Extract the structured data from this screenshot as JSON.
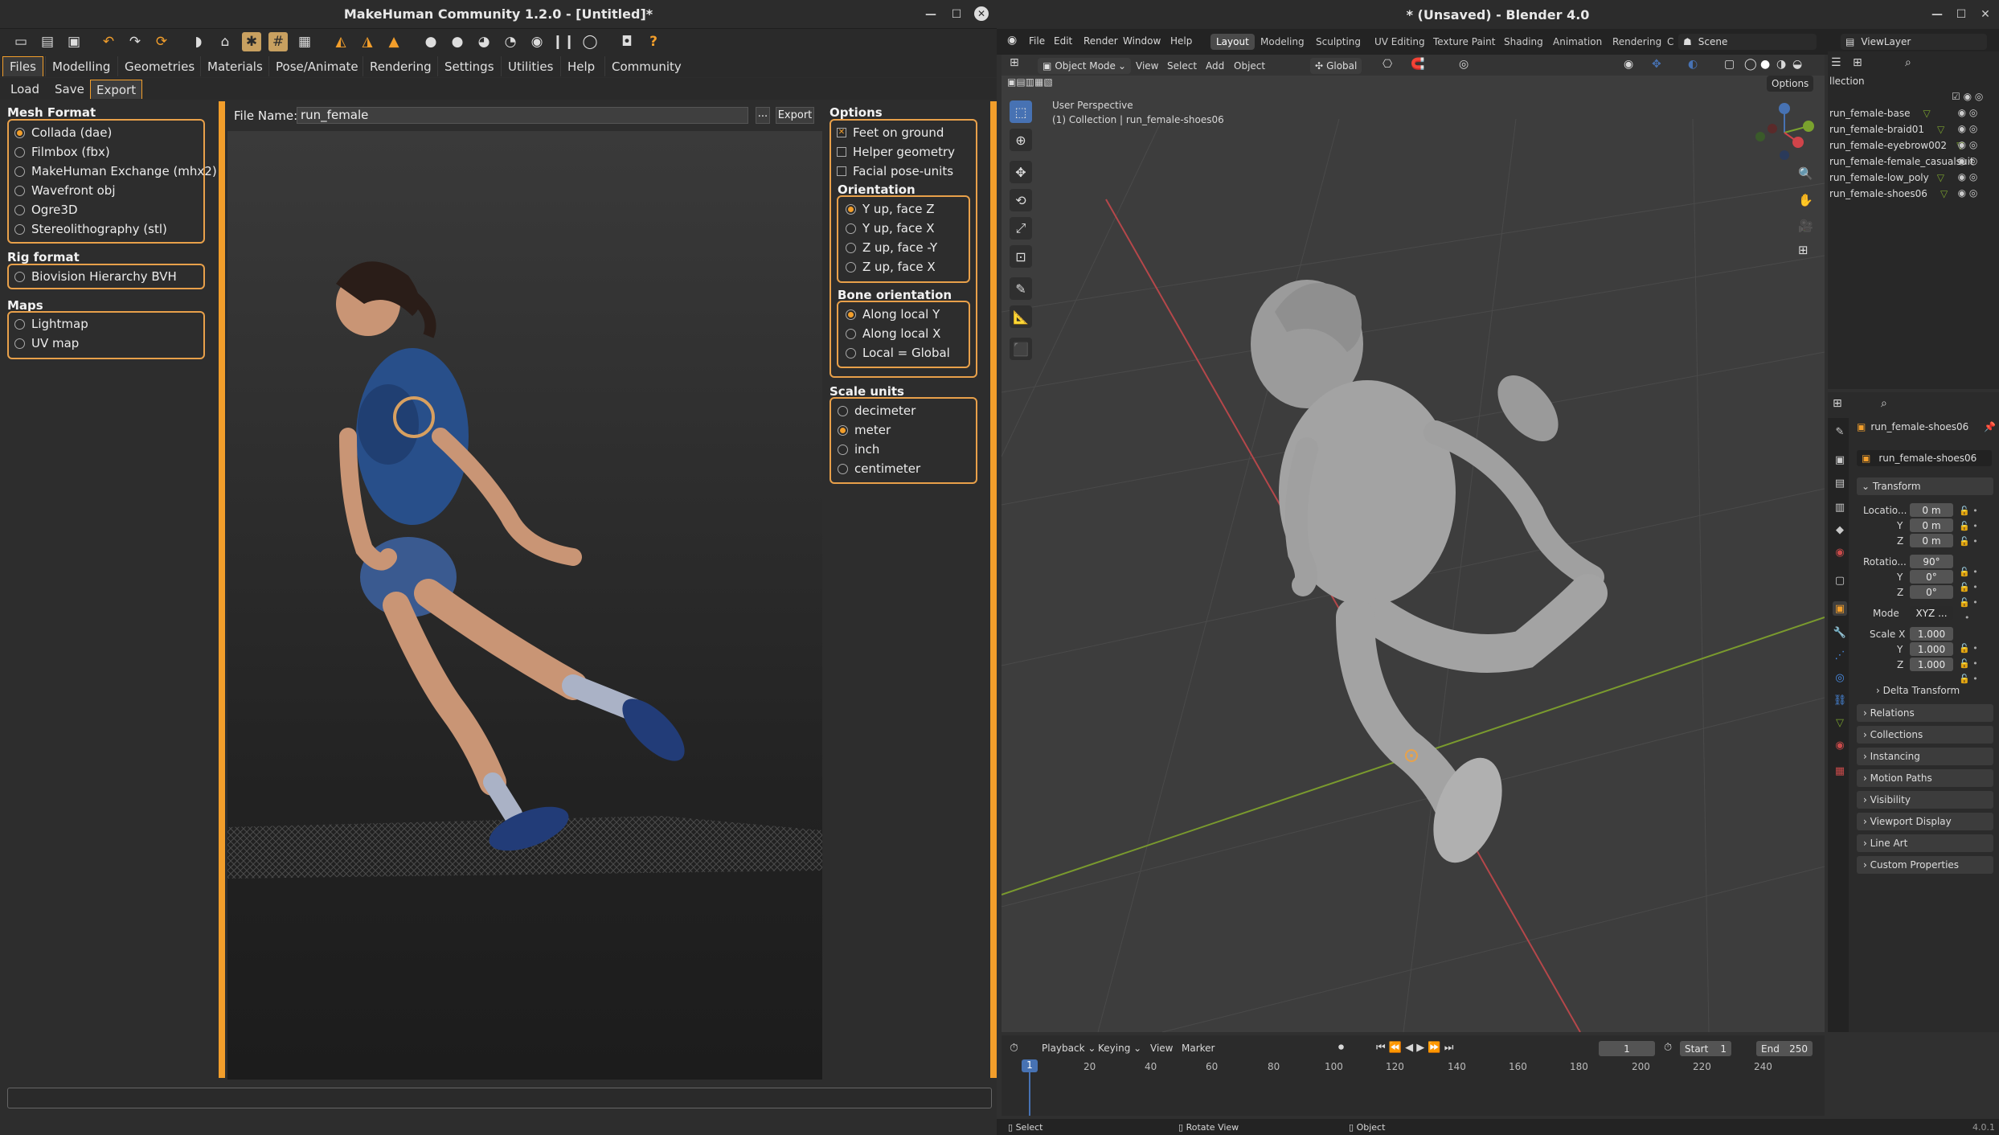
{
  "makehuman": {
    "title": "MakeHuman Community 1.2.0 - [Untitled]*",
    "tabs": [
      "Files",
      "Modelling",
      "Geometries",
      "Materials",
      "Pose/Animate",
      "Rendering",
      "Settings",
      "Utilities",
      "Help",
      "Community"
    ],
    "subtabs": [
      "Load",
      "Save",
      "Export"
    ],
    "mesh_format": {
      "title": "Mesh Format",
      "options": [
        "Collada (dae)",
        "Filmbox (fbx)",
        "MakeHuman Exchange (mhx2)",
        "Wavefront obj",
        "Ogre3D",
        "Stereolithography (stl)"
      ],
      "selected": 0
    },
    "rig_format": {
      "title": "Rig format",
      "options": [
        "Biovision Hierarchy BVH"
      ]
    },
    "maps": {
      "title": "Maps",
      "options": [
        "Lightmap",
        "UV map"
      ]
    },
    "file_name_label": "File Name:",
    "file_name_value": "run_female",
    "browse_label": "...",
    "export_label": "Export",
    "options": {
      "title": "Options",
      "items": [
        "Feet on ground",
        "Helper geometry",
        "Facial pose-units"
      ],
      "checked": [
        true,
        false,
        false
      ]
    },
    "orientation": {
      "title": "Orientation",
      "options": [
        "Y up, face Z",
        "Y up, face X",
        "Z up, face -Y",
        "Z up, face X"
      ],
      "selected": 0
    },
    "bone_orientation": {
      "title": "Bone orientation",
      "options": [
        "Along local Y",
        "Along local X",
        "Local = Global"
      ],
      "selected": 0
    },
    "scale_units": {
      "title": "Scale units",
      "options": [
        "decimeter",
        "meter",
        "inch",
        "centimeter"
      ],
      "selected": 1
    }
  },
  "blender": {
    "title": "* (Unsaved) - Blender 4.0",
    "menu": [
      "File",
      "Edit",
      "Render",
      "Window",
      "Help"
    ],
    "workspaces": [
      "Layout",
      "Modeling",
      "Sculpting",
      "UV Editing",
      "Texture Paint",
      "Shading",
      "Animation",
      "Rendering",
      "C"
    ],
    "scene": "Scene",
    "view_layer": "ViewLayer",
    "mode": "Object Mode",
    "header_menu": [
      "View",
      "Select",
      "Add",
      "Object"
    ],
    "transform_orientation": "Global",
    "options_label": "Options",
    "viewport_label": "User Perspective",
    "viewport_collection": "(1) Collection | run_female-shoes06",
    "outliner_header": "llection",
    "outliner_items": [
      "run_female-base",
      "run_female-braid01",
      "run_female-eyebrow002",
      "run_female-female_casualsuit",
      "run_female-low_poly",
      "run_female-shoes06"
    ],
    "props_object": "run_female-shoes06",
    "props_data": "run_female-shoes06",
    "transform": {
      "title": "Transform",
      "location_label": "Locatio...",
      "location": [
        "0 m",
        "0 m",
        "0 m"
      ],
      "rotation_label": "Rotatio...",
      "rotation": [
        "90°",
        "0°",
        "0°"
      ],
      "mode_label": "Mode",
      "mode": "XYZ ...",
      "scale_label": "Scale X",
      "scale": [
        "1.000",
        "1.000",
        "1.000"
      ],
      "axes": [
        "Y",
        "Z"
      ]
    },
    "delta_transform": "Delta Transform",
    "panels": [
      "Relations",
      "Collections",
      "Instancing",
      "Motion Paths",
      "Visibility",
      "Viewport Display",
      "Line Art",
      "Custom Properties"
    ],
    "timeline": {
      "menu": [
        "Playback",
        "Keying",
        "View",
        "Marker"
      ],
      "current_frame": "1",
      "start_label": "Start",
      "start": "1",
      "end_label": "End",
      "end": "250",
      "ticks": [
        "20",
        "40",
        "60",
        "80",
        "100",
        "120",
        "140",
        "160",
        "180",
        "200",
        "220",
        "240"
      ],
      "cursor": "1"
    },
    "status": {
      "select": "Select",
      "rotate": "Rotate View",
      "object": "Object",
      "version": "4.0.1"
    }
  }
}
